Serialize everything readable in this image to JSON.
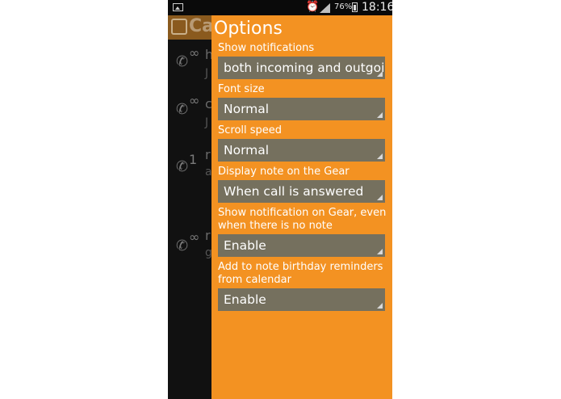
{
  "statusbar": {
    "battery_percent": "76%",
    "time": "18:16",
    "icons": [
      "gallery-icon",
      "alarm-icon",
      "signal-icon",
      "battery-icon"
    ]
  },
  "background_app": {
    "title": "Ca",
    "rows": [
      {
        "badge": "∞",
        "text": "h",
        "sub": "J"
      },
      {
        "badge": "∞",
        "text": "c",
        "sub": "J"
      },
      {
        "badge": "1",
        "text": "r",
        "sub": "a"
      },
      {
        "badge": "∞",
        "text": "r",
        "sub": "g"
      }
    ]
  },
  "options": {
    "title": "Options",
    "items": [
      {
        "label": "Show notifications",
        "value": "both incoming and outgoing"
      },
      {
        "label": "Font size",
        "value": "Normal"
      },
      {
        "label": "Scroll speed",
        "value": "Normal"
      },
      {
        "label": "Display note on the Gear",
        "value": "When call is answered"
      },
      {
        "label": "Show notification on Gear, even when there is no note",
        "value": "Enable"
      },
      {
        "label": "Add to note birthday reminders from calendar",
        "value": "Enable"
      }
    ]
  },
  "colors": {
    "drawer_bg": "#f39222",
    "select_bg": "#75705e",
    "app_bg": "#111111"
  }
}
